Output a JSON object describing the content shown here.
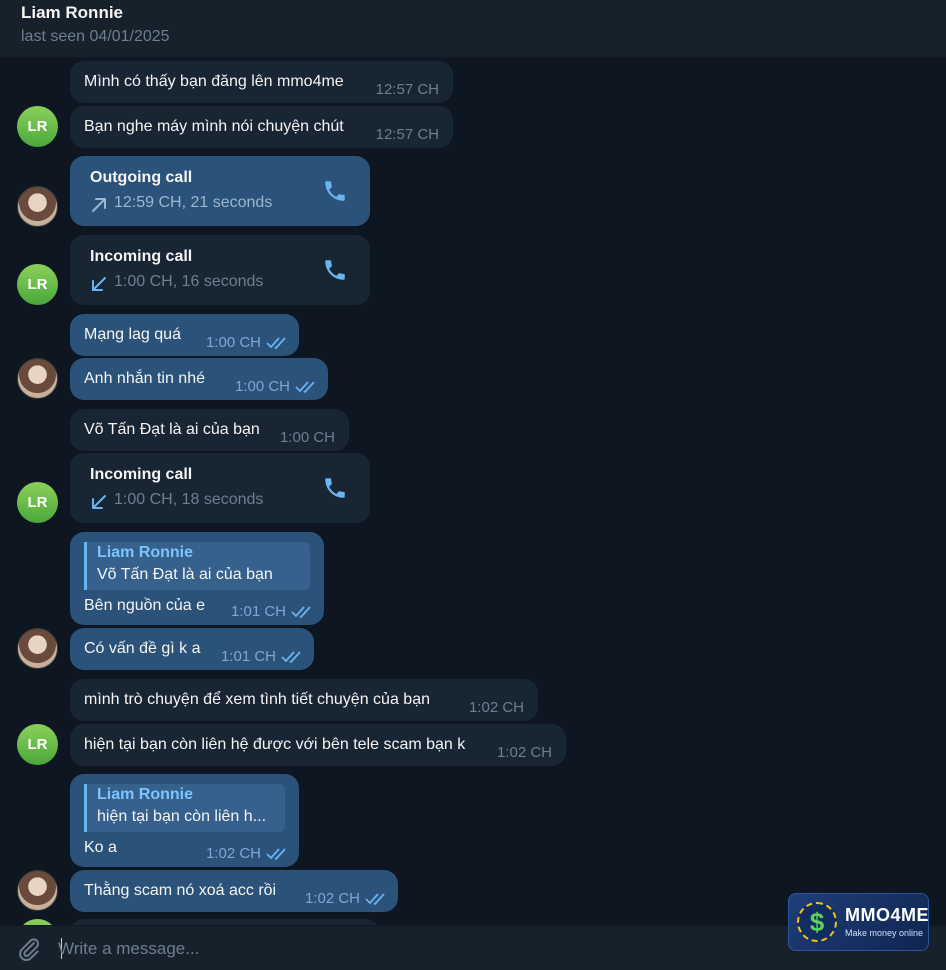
{
  "header": {
    "name": "Liam Ronnie",
    "status": "last seen 04/01/2025"
  },
  "avatars": {
    "contact_initials": "LR"
  },
  "messages": {
    "m1": {
      "text": "Mình có thấy bạn đăng lên mmo4me",
      "time": "12:57 CH"
    },
    "m2": {
      "text": "Bạn nghe máy mình nói chuyện chút",
      "time": "12:57 CH"
    },
    "call1": {
      "title": "Outgoing call",
      "meta": "12:59 CH, 21 seconds"
    },
    "call2": {
      "title": "Incoming call",
      "meta": "1:00 CH, 16 seconds"
    },
    "m3": {
      "text": "Mạng lag quá",
      "time": "1:00 CH"
    },
    "m4": {
      "text": "Anh nhắn tin nhé",
      "time": "1:00 CH"
    },
    "m5": {
      "text": "Võ Tấn Đạt là ai của bạn",
      "time": "1:00 CH"
    },
    "call3": {
      "title": "Incoming call",
      "meta": "1:00 CH, 18 seconds"
    },
    "r1": {
      "quote_name": "Liam Ronnie",
      "quote_text": "Võ Tấn Đạt là ai của bạn",
      "text": "Bên nguồn của e",
      "time": "1:01 CH"
    },
    "m6": {
      "text": "Có vấn đề gì k a",
      "time": "1:01 CH"
    },
    "m7": {
      "text": "mình trò chuyện để xem tình tiết chuyện của bạn",
      "time": "1:02 CH"
    },
    "m8": {
      "text": "hiện tại bạn còn liên hệ được với bên tele scam bạn k",
      "time": "1:02 CH"
    },
    "r2": {
      "quote_name": "Liam Ronnie",
      "quote_text": "hiện tại bạn còn liên h...",
      "text": "Ko a",
      "time": "1:02 CH"
    },
    "m9": {
      "text": "Thằng scam nó xoá acc rồi",
      "time": "1:02 CH"
    }
  },
  "composer": {
    "placeholder": "Write a message..."
  },
  "watermark": {
    "brand": "MMO4ME",
    "tagline": "Make money online",
    "symbol": "$"
  },
  "colors": {
    "background": "#0e1621",
    "incoming_bubble": "#182533",
    "outgoing_bubble": "#2b5278",
    "accent": "#6ab3f3",
    "avatar_green": "#4aa83a"
  }
}
